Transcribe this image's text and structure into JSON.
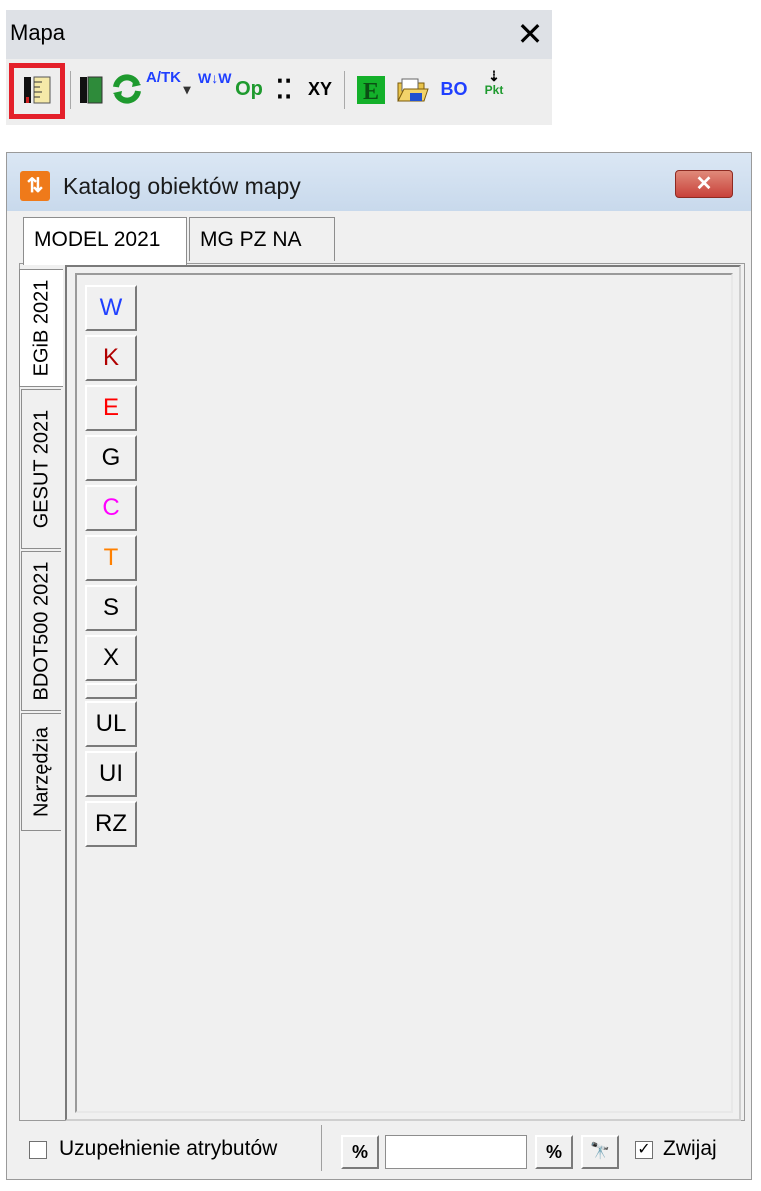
{
  "toolbar": {
    "title": "Mapa",
    "close": "✕",
    "icons": [
      "ruler-icon",
      "ruler-icon-2",
      "refresh-icon",
      "atk-icon",
      "dropdown-arrow-icon",
      "ww-icon",
      "op-icon",
      "dots-icon",
      "xy-icon",
      "e-icon",
      "open-folder-icon",
      "bo-icon",
      "pkt-icon"
    ],
    "labels": {
      "atk": "A/TK",
      "ww": "W↓W",
      "op": "Op",
      "dots": "⁚⁚",
      "xy": "XY",
      "e": "E",
      "bo": "BO",
      "pkt": "Pkt"
    }
  },
  "dialog": {
    "title": "Katalog obiektów mapy",
    "close": "✕",
    "top_tabs": [
      {
        "label": "MODEL 2021",
        "active": true
      },
      {
        "label": "MG PZ NA",
        "active": false
      }
    ],
    "side_tabs": [
      {
        "label": "EGiB 2021",
        "active": true
      },
      {
        "label": "GESUT 2021",
        "active": false
      },
      {
        "label": "BDOT500 2021",
        "active": false
      },
      {
        "label": "Narzędzia",
        "active": false
      }
    ],
    "letter_buttons": [
      {
        "label": "W",
        "color": "#1f3fff"
      },
      {
        "label": "K",
        "color": "#b00000"
      },
      {
        "label": "E",
        "color": "#ff0000"
      },
      {
        "label": "G",
        "color": "#000000"
      },
      {
        "label": "C",
        "color": "#ff00ff"
      },
      {
        "label": "T",
        "color": "#ff8000"
      },
      {
        "label": "S",
        "color": "#000000"
      },
      {
        "label": "X",
        "color": "#000000"
      },
      {
        "label": "UL",
        "color": "#000000"
      },
      {
        "label": "UI",
        "color": "#000000"
      },
      {
        "label": "RZ",
        "color": "#000000"
      }
    ],
    "bottom": {
      "attr_checkbox_label": "Uzupełnienie atrybutów",
      "attr_checked": false,
      "percent_left": "%",
      "search_value": "",
      "percent_right": "%",
      "find": "🔭",
      "collapse_label": "Zwijaj",
      "collapse_checked": true,
      "check_mark": "✓"
    }
  }
}
